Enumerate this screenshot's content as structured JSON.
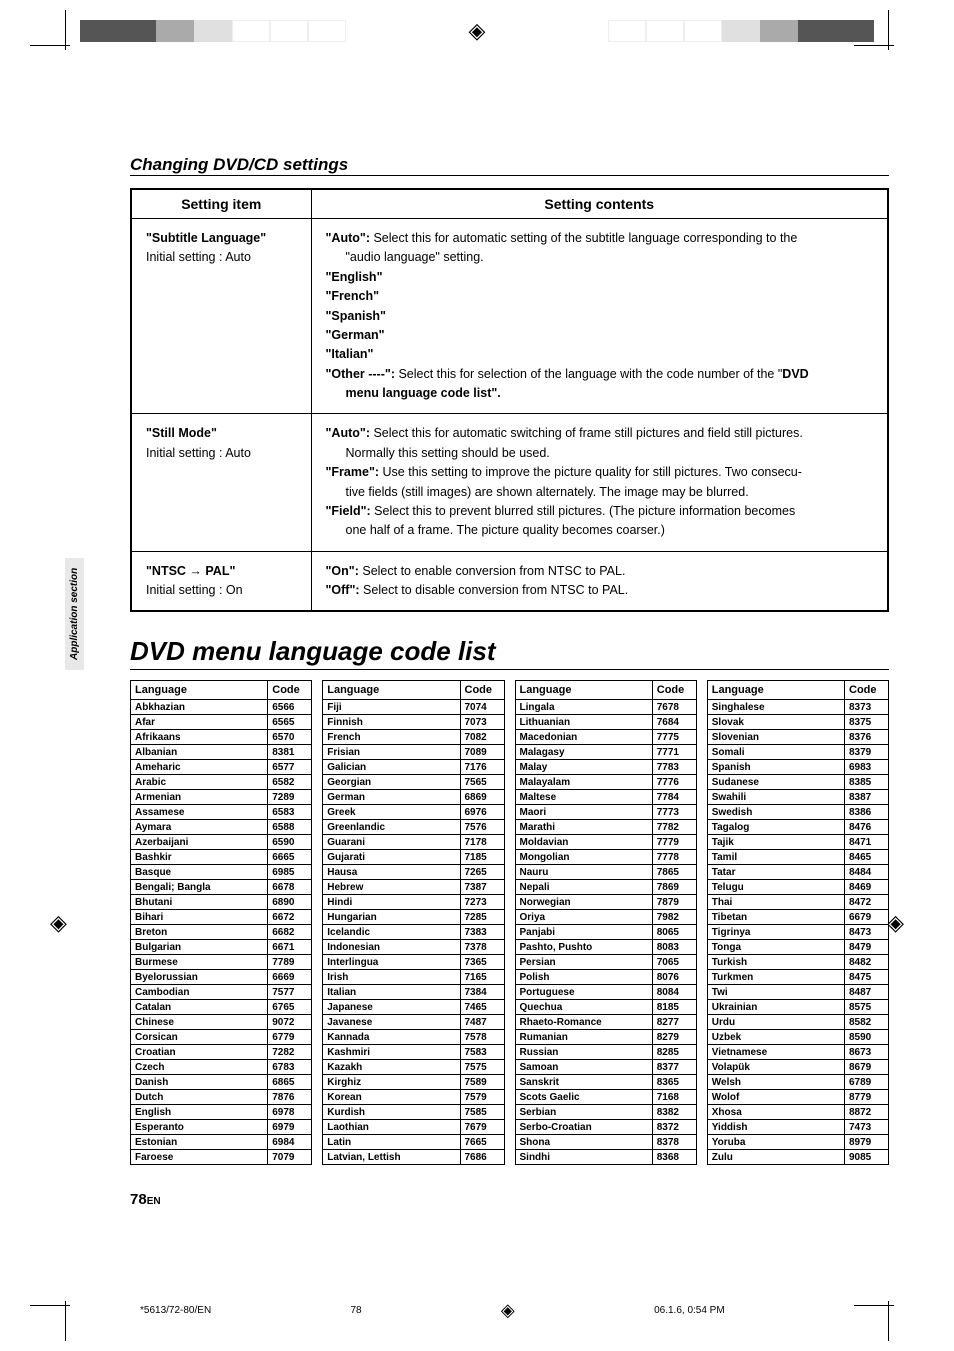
{
  "sectionTitle": "Changing DVD/CD settings",
  "settingsHead": {
    "item": "Setting item",
    "contents": "Setting contents"
  },
  "row1": {
    "titleA": "\"Subtitle Language\"",
    "titleB": "Initial setting : Auto",
    "autoLine": "\"Auto\": ",
    "autoDesc": "Select this for automatic setting of the subtitle language corresponding to the",
    "autoDesc2": "\"audio language\" setting.",
    "en": "\"English\"",
    "fr": "\"French\"",
    "es": "\"Spanish\"",
    "de": "\"German\"",
    "it": "\"Italian\"",
    "otherA": "\"Other ----\": ",
    "otherB": "Select this for selection of the language with the code number of the \"",
    "otherC": "DVD",
    "otherD": "menu language code list\"."
  },
  "row2": {
    "titleA": "\"Still Mode\"",
    "titleB": "Initial setting : Auto",
    "autoA": "\"Auto\": ",
    "autoB": "Select this for automatic switching of frame still pictures and field still pictures.",
    "autoC": "Normally this setting should be used.",
    "frameA": "\"Frame\": ",
    "frameB": "Use this setting to improve the picture quality for still pictures. Two consecu-",
    "frameC": "tive fields (still images) are shown alternately. The image may be blurred.",
    "fieldA": "\"Field\": ",
    "fieldB": "Select this to prevent blurred still pictures. (The picture information becomes",
    "fieldC": "one half of a frame. The picture quality becomes coarser.)"
  },
  "row3": {
    "titleA": "\"NTSC → PAL\"",
    "titleB": "Initial setting : On",
    "onA": "\"On\": ",
    "onB": "Select to enable  conversion from NTSC to PAL.",
    "offA": "\"Off\": ",
    "offB": "Select to disable conversion from NTSC to PAL."
  },
  "listTitle": "DVD menu language code list",
  "th": {
    "lang": "Language",
    "code": "Code"
  },
  "col1": [
    [
      "Abkhazian",
      "6566"
    ],
    [
      "Afar",
      "6565"
    ],
    [
      "Afrikaans",
      "6570"
    ],
    [
      "Albanian",
      "8381"
    ],
    [
      "Ameharic",
      "6577"
    ],
    [
      "Arabic",
      "6582"
    ],
    [
      "Armenian",
      "7289"
    ],
    [
      "Assamese",
      "6583"
    ],
    [
      "Aymara",
      "6588"
    ],
    [
      "Azerbaijani",
      "6590"
    ],
    [
      "Bashkir",
      "6665"
    ],
    [
      "Basque",
      "6985"
    ],
    [
      "Bengali; Bangla",
      "6678"
    ],
    [
      "Bhutani",
      "6890"
    ],
    [
      "Bihari",
      "6672"
    ],
    [
      "Breton",
      "6682"
    ],
    [
      "Bulgarian",
      "6671"
    ],
    [
      "Burmese",
      "7789"
    ],
    [
      "Byelorussian",
      "6669"
    ],
    [
      "Cambodian",
      "7577"
    ],
    [
      "Catalan",
      "6765"
    ],
    [
      "Chinese",
      "9072"
    ],
    [
      "Corsican",
      "6779"
    ],
    [
      "Croatian",
      "7282"
    ],
    [
      "Czech",
      "6783"
    ],
    [
      "Danish",
      "6865"
    ],
    [
      "Dutch",
      "7876"
    ],
    [
      "English",
      "6978"
    ],
    [
      "Esperanto",
      "6979"
    ],
    [
      "Estonian",
      "6984"
    ],
    [
      "Faroese",
      "7079"
    ]
  ],
  "col2": [
    [
      "Fiji",
      "7074"
    ],
    [
      "Finnish",
      "7073"
    ],
    [
      "French",
      "7082"
    ],
    [
      "Frisian",
      "7089"
    ],
    [
      "Galician",
      "7176"
    ],
    [
      "Georgian",
      "7565"
    ],
    [
      "German",
      "6869"
    ],
    [
      "Greek",
      "6976"
    ],
    [
      "Greenlandic",
      "7576"
    ],
    [
      "Guarani",
      "7178"
    ],
    [
      "Gujarati",
      "7185"
    ],
    [
      "Hausa",
      "7265"
    ],
    [
      "Hebrew",
      "7387"
    ],
    [
      "Hindi",
      "7273"
    ],
    [
      "Hungarian",
      "7285"
    ],
    [
      "Icelandic",
      "7383"
    ],
    [
      "Indonesian",
      "7378"
    ],
    [
      "Interlingua",
      "7365"
    ],
    [
      "Irish",
      "7165"
    ],
    [
      "Italian",
      "7384"
    ],
    [
      "Japanese",
      "7465"
    ],
    [
      "Javanese",
      "7487"
    ],
    [
      "Kannada",
      "7578"
    ],
    [
      "Kashmiri",
      "7583"
    ],
    [
      "Kazakh",
      "7575"
    ],
    [
      "Kirghiz",
      "7589"
    ],
    [
      "Korean",
      "7579"
    ],
    [
      "Kurdish",
      "7585"
    ],
    [
      "Laothian",
      "7679"
    ],
    [
      "Latin",
      "7665"
    ],
    [
      "Latvian, Lettish",
      "7686"
    ]
  ],
  "col3": [
    [
      "Lingala",
      "7678"
    ],
    [
      "Lithuanian",
      "7684"
    ],
    [
      "Macedonian",
      "7775"
    ],
    [
      "Malagasy",
      "7771"
    ],
    [
      "Malay",
      "7783"
    ],
    [
      "Malayalam",
      "7776"
    ],
    [
      "Maltese",
      "7784"
    ],
    [
      "Maori",
      "7773"
    ],
    [
      "Marathi",
      "7782"
    ],
    [
      "Moldavian",
      "7779"
    ],
    [
      "Mongolian",
      "7778"
    ],
    [
      "Nauru",
      "7865"
    ],
    [
      "Nepali",
      "7869"
    ],
    [
      "Norwegian",
      "7879"
    ],
    [
      "Oriya",
      "7982"
    ],
    [
      "Panjabi",
      "8065"
    ],
    [
      "Pashto, Pushto",
      "8083"
    ],
    [
      "Persian",
      "7065"
    ],
    [
      "Polish",
      "8076"
    ],
    [
      "Portuguese",
      "8084"
    ],
    [
      "Quechua",
      "8185"
    ],
    [
      "Rhaeto-Romance",
      "8277"
    ],
    [
      "Rumanian",
      "8279"
    ],
    [
      "Russian",
      "8285"
    ],
    [
      "Samoan",
      "8377"
    ],
    [
      "Sanskrit",
      "8365"
    ],
    [
      "Scots Gaelic",
      "7168"
    ],
    [
      "Serbian",
      "8382"
    ],
    [
      "Serbo-Croatian",
      "8372"
    ],
    [
      "Shona",
      "8378"
    ],
    [
      "Sindhi",
      "8368"
    ]
  ],
  "col4": [
    [
      "Singhalese",
      "8373"
    ],
    [
      "Slovak",
      "8375"
    ],
    [
      "Slovenian",
      "8376"
    ],
    [
      "Somali",
      "8379"
    ],
    [
      "Spanish",
      "6983"
    ],
    [
      "Sudanese",
      "8385"
    ],
    [
      "Swahili",
      "8387"
    ],
    [
      "Swedish",
      "8386"
    ],
    [
      "Tagalog",
      "8476"
    ],
    [
      "Tajik",
      "8471"
    ],
    [
      "Tamil",
      "8465"
    ],
    [
      "Tatar",
      "8484"
    ],
    [
      "Telugu",
      "8469"
    ],
    [
      "Thai",
      "8472"
    ],
    [
      "Tibetan",
      "6679"
    ],
    [
      "Tigrinya",
      "8473"
    ],
    [
      "Tonga",
      "8479"
    ],
    [
      "Turkish",
      "8482"
    ],
    [
      "Turkmen",
      "8475"
    ],
    [
      "Twi",
      "8487"
    ],
    [
      "Ukrainian",
      "8575"
    ],
    [
      "Urdu",
      "8582"
    ],
    [
      "Uzbek",
      "8590"
    ],
    [
      "Vietnamese",
      "8673"
    ],
    [
      "Volapük",
      "8679"
    ],
    [
      "Welsh",
      "6789"
    ],
    [
      "Wolof",
      "8779"
    ],
    [
      "Xhosa",
      "8872"
    ],
    [
      "Yiddish",
      "7473"
    ],
    [
      "Yoruba",
      "8979"
    ],
    [
      "Zulu",
      "9085"
    ]
  ],
  "pageNum": "78",
  "pageSuffix": "EN",
  "sideTab": "Application section",
  "footL": "*5613/72-80/EN",
  "footC": "78",
  "footR": "06.1.6, 0:54 PM"
}
